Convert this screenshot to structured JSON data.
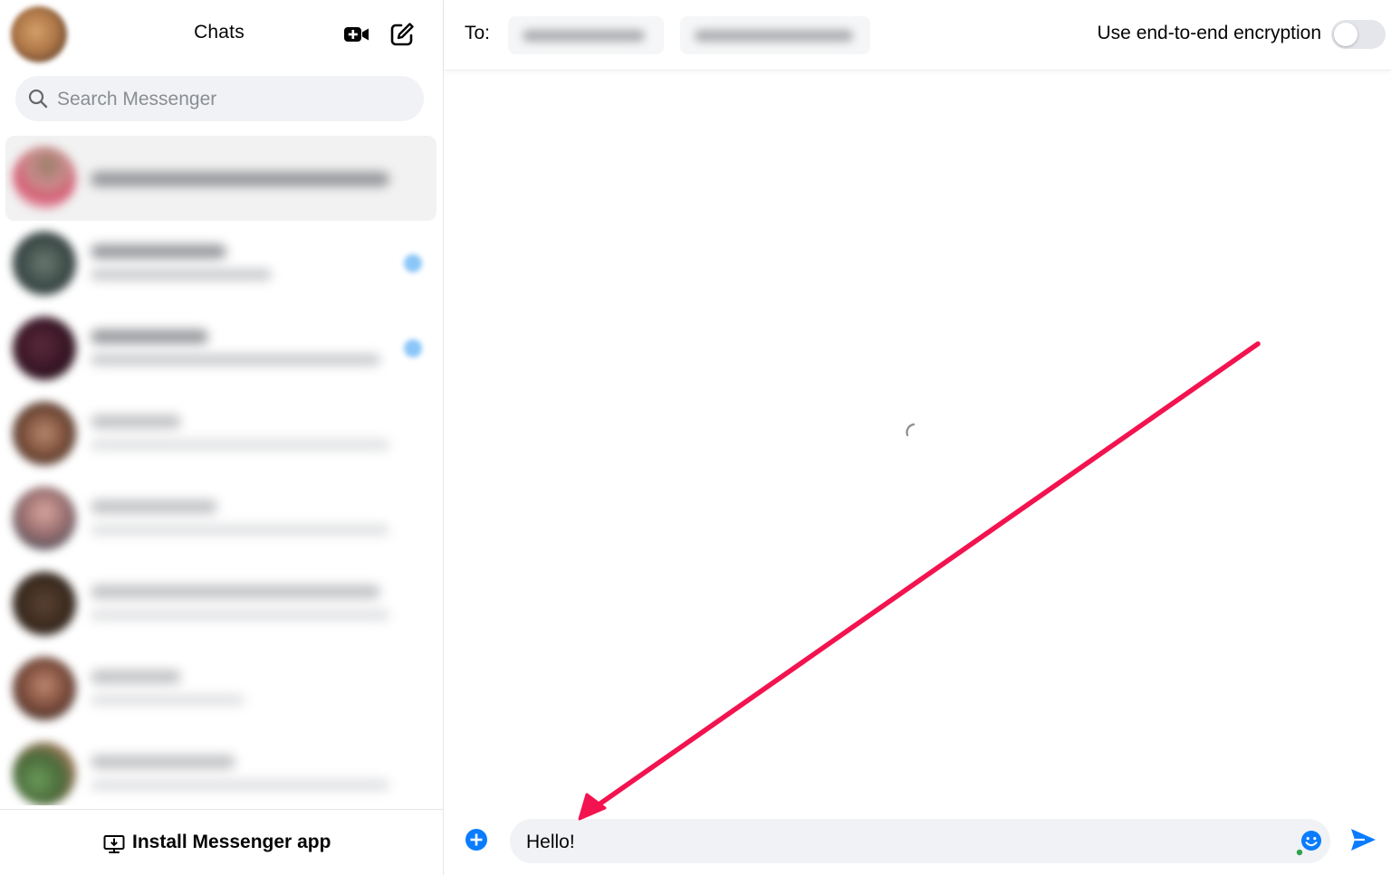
{
  "sidebar": {
    "title": "Chats",
    "search": {
      "placeholder": "Search Messenger",
      "value": ""
    },
    "header_icons": [
      "video-call-icon",
      "compose-icon"
    ],
    "footer": {
      "install_label": "Install Messenger app"
    }
  },
  "conversation": {
    "to_label": "To:",
    "encryption": {
      "label": "Use end-to-end encryption",
      "enabled": false
    },
    "composer": {
      "value": "Hello!",
      "placeholder": ""
    }
  },
  "colors": {
    "accent": "#0a7cff",
    "annotation_arrow": "#f2134f",
    "toggle_off": "#e4e6eb",
    "search_bg": "#f0f2f5"
  }
}
